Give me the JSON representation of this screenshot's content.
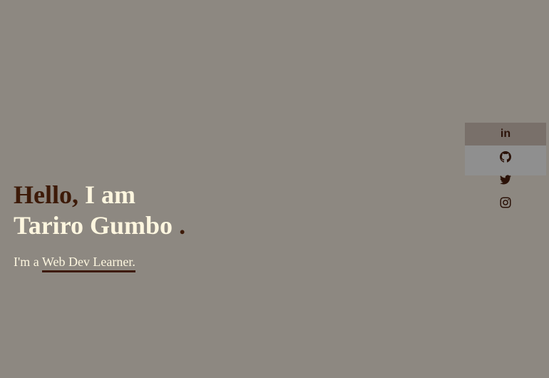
{
  "hero": {
    "hello": "Hello,",
    "iam": " I am",
    "name": "Tariro Gumbo",
    "dot": " .",
    "intro": "I'm a ",
    "role": "Web Dev Learner."
  },
  "social": {
    "items": [
      {
        "name": "linkedin",
        "icon": "linkedin-icon",
        "label": "in"
      },
      {
        "name": "github",
        "icon": "github-icon"
      },
      {
        "name": "twitter",
        "icon": "twitter-icon"
      },
      {
        "name": "instagram",
        "icon": "instagram-icon"
      }
    ]
  },
  "colors": {
    "background": "#8d8881",
    "accent_dark": "#3d1a08",
    "text_light": "#fdf6df",
    "linkedin_bg": "#79706a",
    "github_bg": "#8f8f8f"
  }
}
